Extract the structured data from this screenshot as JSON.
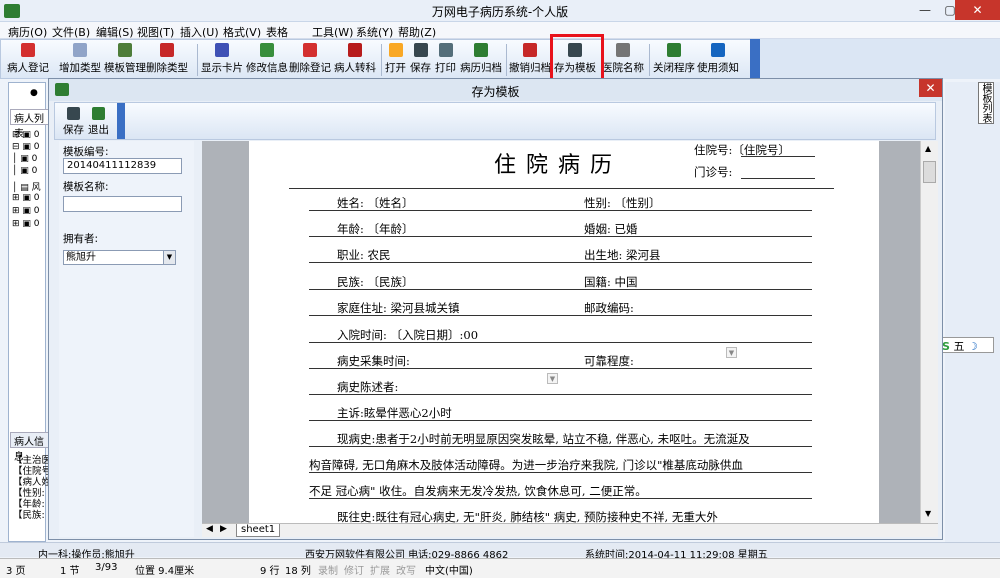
{
  "app": {
    "title": "万网电子病历系统-个人版"
  },
  "menu": [
    "病历(O)",
    "文件(B)",
    "编辑(S)",
    "视图(T)",
    "插入(U)",
    "格式(V)",
    "表格",
    "工具(W)",
    "系统(Y)",
    "帮助(Z)"
  ],
  "toolbar": [
    {
      "label": "病人登记",
      "icon": "add-patient-icon",
      "color": "#d32f2f"
    },
    {
      "label": "增加类型",
      "icon": "add-type-icon",
      "color": "#90a4c8"
    },
    {
      "label": "模板管理",
      "icon": "template-manage-icon",
      "color": "#4e7d3a"
    },
    {
      "label": "删除类型",
      "icon": "delete-type-icon",
      "color": "#c62828"
    },
    {
      "label": "显示卡片",
      "icon": "card-icon",
      "color": "#3f51b5"
    },
    {
      "label": "修改信息",
      "icon": "edit-info-icon",
      "color": "#388e3c"
    },
    {
      "label": "删除登记",
      "icon": "delete-record-icon",
      "color": "#d32f2f"
    },
    {
      "label": "病人转科",
      "icon": "transfer-icon",
      "color": "#b71c1c"
    },
    {
      "label": "打开",
      "icon": "open-folder-icon",
      "color": "#f9a825"
    },
    {
      "label": "保存",
      "icon": "save-icon",
      "color": "#37474f"
    },
    {
      "label": "打印",
      "icon": "print-icon",
      "color": "#546e7a"
    },
    {
      "label": "病历归档",
      "icon": "archive-icon",
      "color": "#2e7d32"
    },
    {
      "label": "撤销归档",
      "icon": "undo-archive-icon",
      "color": "#c62828"
    },
    {
      "label": "存为模板",
      "icon": "save-template-icon",
      "color": "#37474f"
    },
    {
      "label": "医院名称",
      "icon": "key-icon",
      "color": "#757575"
    },
    {
      "label": "关闭程序",
      "icon": "exit-icon",
      "color": "#2e7d32"
    },
    {
      "label": "使用须知",
      "icon": "notice-icon",
      "color": "#1565c0"
    }
  ],
  "left": {
    "patients_tab": "病人列表",
    "info_tab": "病人信息",
    "info_lines": [
      "【主治医",
      "【住院号",
      "【病人姓",
      "【性别:",
      "【年龄:",
      "【民族:"
    ]
  },
  "side_tab": "模板列表",
  "float_bar": "五",
  "dialog": {
    "title": "存为模板",
    "save": "保存",
    "exit": "退出",
    "id_label": "模板编号:",
    "id_value": "20140411112839",
    "name_label": "模板名称:",
    "name_value": "",
    "owner_label": "拥有者:",
    "owner_value": "熊旭升",
    "sheet_tab": "sheet1"
  },
  "doc": {
    "title": "住院病历",
    "admission_no": "住院号:〔住院号〕",
    "outpatient_no": "门诊号:",
    "rows": [
      {
        "left": "姓名: 〔姓名〕",
        "right": "性别: 〔性别〕"
      },
      {
        "left": "年龄: 〔年龄〕",
        "right": "婚姻: 已婚"
      },
      {
        "left": "职业: 农民",
        "right": "出生地: 梁河县"
      },
      {
        "left": "民族: 〔民族〕",
        "right": "国籍: 中国"
      },
      {
        "left": "家庭住址: 梁河县城关镇",
        "right": "邮政编码:"
      }
    ],
    "admit_time": "入院时间: 〔入院日期〕:00",
    "history_time": "病史采集时间:",
    "reliability": "可靠程度:",
    "narrator": "病史陈述者:",
    "chief": "主诉:眩晕伴恶心2小时",
    "present1": "现病史:患者于2小时前无明显原因突发眩晕, 站立不稳, 伴恶心, 未呕吐。无流涎及",
    "present2": "构音障碍, 无口角麻木及肢体活动障碍。为进一步治疗来我院, 门诊以\"椎基底动脉供血",
    "present3": "不足 冠心病\" 收住。自发病来无发冷发热, 饮食休息可, 二便正常。",
    "past": "既往史:既往有冠心病史, 无\"肝炎, 肺结核\" 病史, 预防接种史不祥, 无重大外"
  },
  "status1": {
    "left": "内一科:操作员:熊旭升",
    "company": "西安万网软件有限公司 电话:029-8866 4862",
    "time": "系统时间:2014-04-11 11:29:08 星期五"
  },
  "status2": [
    "3 页",
    "1 节",
    "3/93",
    "位置 9.4厘米",
    "9 行",
    "18 列",
    "录制",
    "修订",
    "扩展",
    "改写",
    "中文(中国)"
  ]
}
